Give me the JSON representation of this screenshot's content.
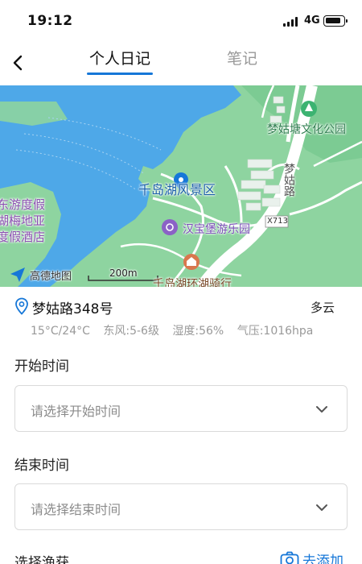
{
  "status": {
    "time": "19:12",
    "network": "4G"
  },
  "nav": {
    "tabs": [
      {
        "label": "个人日记"
      },
      {
        "label": "笔记"
      }
    ]
  },
  "map": {
    "labels": {
      "park": "梦姑塘文化公园",
      "scenic": "千岛湖风景区",
      "amusement": "汉宝堡游乐园",
      "road_vertical": "梦姑路",
      "road_code": "X713",
      "hotel_line1": "东游度假",
      "hotel_line2": "湖梅地亚",
      "hotel_line3": "度假酒店",
      "cycling": "千岛湖环湖骑行",
      "provider": "高德地图",
      "scale": "200m"
    },
    "colors": {
      "water": "#4ea8e8",
      "land": "#8ed4a0",
      "road": "#ffffff"
    }
  },
  "location": {
    "address": "梦姑路348号",
    "condition": "多云",
    "temperature": "15°C/24°C",
    "wind": "东风:5-6级",
    "humidity": "湿度:56%",
    "pressure": "气压:1016hpa"
  },
  "form": {
    "start_label": "开始时间",
    "start_placeholder": "请选择开始时间",
    "end_label": "结束时间",
    "end_placeholder": "请选择结束时间",
    "catch_label": "选择渔获",
    "add_label": "去添加"
  },
  "colors": {
    "accent": "#1677d8",
    "placeholder": "#8c8c8c"
  }
}
